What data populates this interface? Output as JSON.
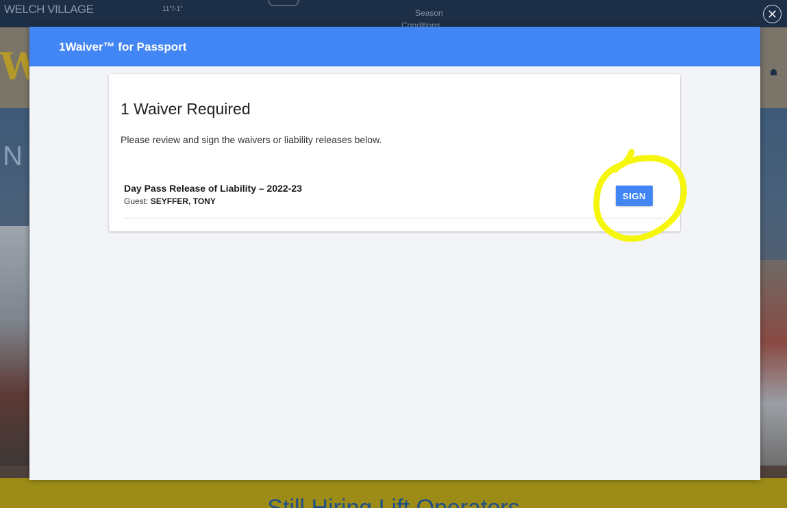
{
  "background": {
    "brand": "WELCH VILLAGE",
    "temperature": "11°/-1°",
    "season_label": "Season",
    "conditions_label": "Conditions",
    "close_icon": "close-circle-icon",
    "banner_text": "Still Hiring Lift Operators",
    "colors": {
      "topbar": "#1d2f47",
      "banner": "#9c8c17",
      "banner_text": "#1f4f88"
    }
  },
  "modal": {
    "title": "1Waiver™ for Passport",
    "header_color": "#4285f4",
    "card": {
      "heading": "1 Waiver Required",
      "description": "Please review and sign the waivers or liability releases below.",
      "waivers": [
        {
          "name": "Day Pass Release of Liability – 2022-23",
          "guest_label": "Guest:",
          "guest_name": "SEYFFER, TONY",
          "action_label": "SIGN"
        }
      ]
    }
  },
  "annotation": {
    "highlight_color": "#f5f500",
    "target": "sign-button"
  }
}
